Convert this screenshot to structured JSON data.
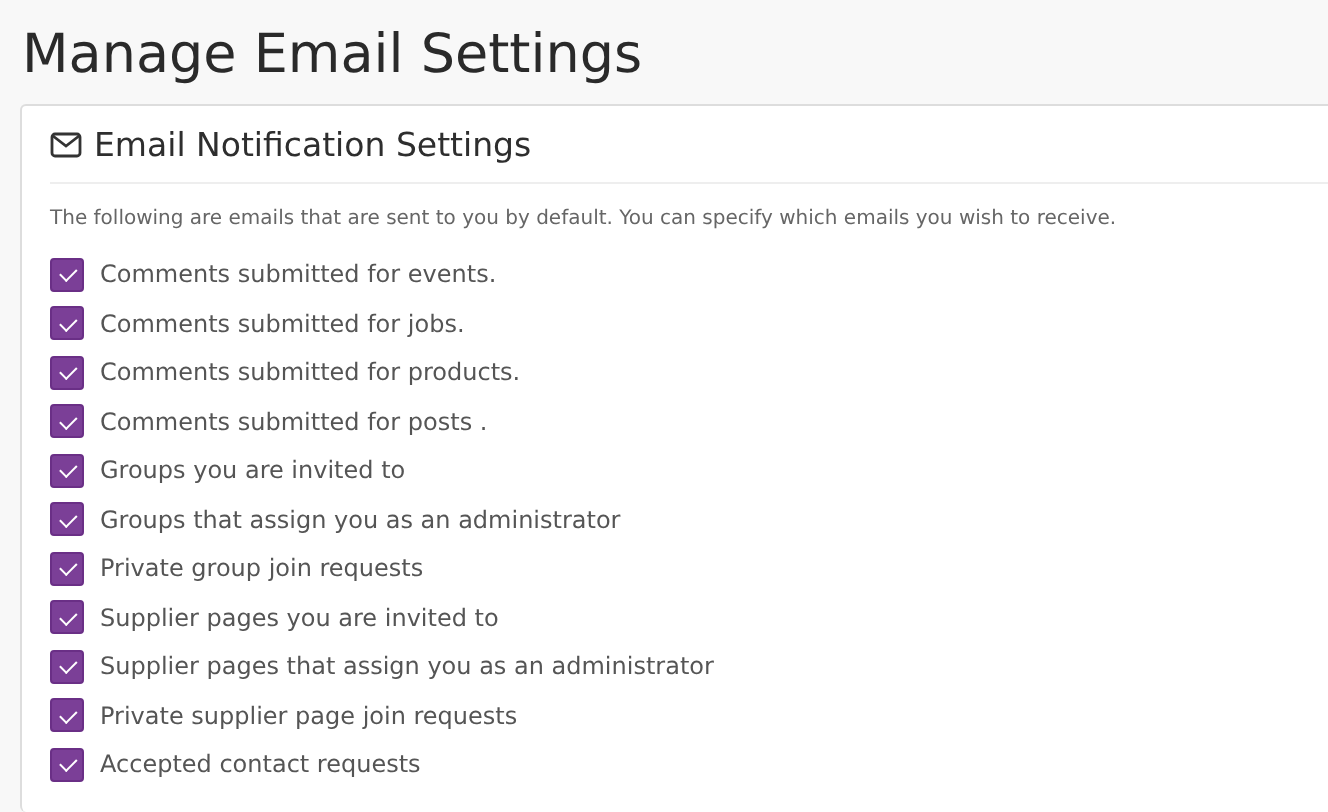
{
  "page": {
    "title": "Manage Email Settings"
  },
  "card": {
    "title": "Email Notification Settings",
    "description": "The following are emails that are sent to you by default. You can specify which emails you wish to receive.",
    "options": [
      {
        "label": "Comments submitted for events.",
        "checked": true
      },
      {
        "label": "Comments submitted for jobs.",
        "checked": true
      },
      {
        "label": "Comments submitted for products.",
        "checked": true
      },
      {
        "label": "Comments submitted for posts .",
        "checked": true
      },
      {
        "label": "Groups you are invited to",
        "checked": true
      },
      {
        "label": "Groups that assign you as an administrator",
        "checked": true
      },
      {
        "label": "Private group join requests",
        "checked": true
      },
      {
        "label": "Supplier pages you are invited to",
        "checked": true
      },
      {
        "label": "Supplier pages that assign you as an administrator",
        "checked": true
      },
      {
        "label": "Private supplier page join requests",
        "checked": true
      },
      {
        "label": "Accepted contact requests",
        "checked": true
      }
    ]
  }
}
